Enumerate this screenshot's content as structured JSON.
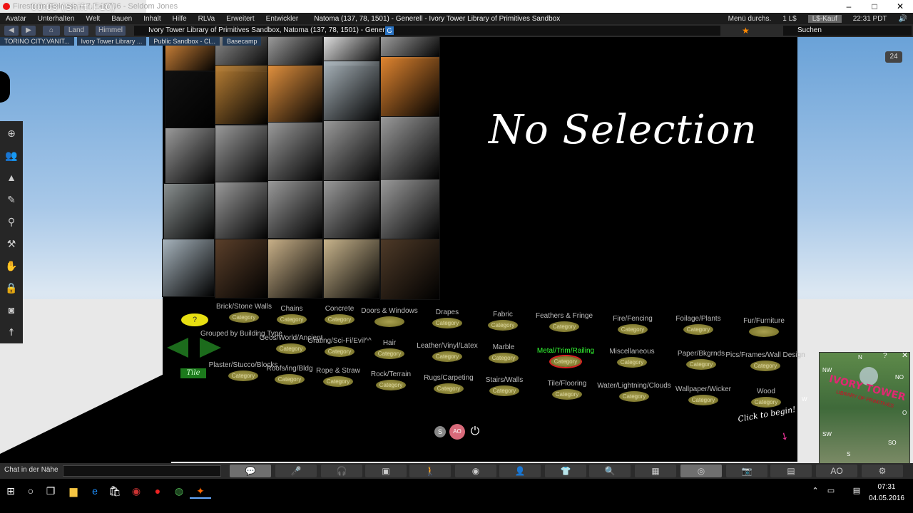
{
  "window": {
    "title": "Firestorm-Release 4.7.7.48706 - Seldom Jones",
    "recording_overlay": "00:03 (Shift+F10)",
    "controls": [
      "–",
      "□",
      "✕"
    ]
  },
  "menu": {
    "items": [
      "Avatar",
      "Unterhalten",
      "Welt",
      "Bauen",
      "Inhalt",
      "Hilfe",
      "RLVa",
      "Erweitert",
      "Entwickler"
    ],
    "location": "Natoma (137, 78, 1501) - Generell - Ivory Tower Library of Primitives Sandbox",
    "search_menu": "Menü durchs.",
    "balance": "1 L$",
    "buy": "L$-Kauf",
    "time": "22:31 PDT"
  },
  "nav": {
    "land": "Land",
    "sky": "Himmel",
    "url": "Ivory Tower Library of Primitives Sandbox, Natoma (137, 78, 1501) - Generell",
    "search_placeholder": "Suchen"
  },
  "favorites": [
    "TORINO CITY.VANIT...",
    "Ivory Tower Library ...",
    "Public Sandbox - Cl...",
    "Basecamp"
  ],
  "scene": {
    "no_selection": "No Selection",
    "badge": "24",
    "click_to_begin": "Click to begin!",
    "tile_label": "Tile",
    "grouped_label": "Grouped by Building Type",
    "hud_ao": "AO"
  },
  "categories": [
    {
      "label": "Brick/Stone Walls",
      "btn": "Category",
      "active": false
    },
    {
      "label": "Chains",
      "btn": "Category",
      "active": false
    },
    {
      "label": "Concrete",
      "btn": "Category",
      "active": false
    },
    {
      "label": "Doors & Windows",
      "btn": "",
      "active": false
    },
    {
      "label": "Drapes",
      "btn": "Category",
      "active": false
    },
    {
      "label": "Fabric",
      "btn": "Category",
      "active": false
    },
    {
      "label": "Feathers & Fringe",
      "btn": "Category",
      "active": false
    },
    {
      "label": "Fire/Fencing",
      "btn": "Category",
      "active": false
    },
    {
      "label": "Foilage/Plants",
      "btn": "Category",
      "active": false
    },
    {
      "label": "Fur/Furniture",
      "btn": "",
      "active": false
    },
    {
      "label": "Geos/World/Ancient",
      "btn": "Category",
      "active": false
    },
    {
      "label": "Grating/Sci-Fi/Evil^^",
      "btn": "Category",
      "active": false
    },
    {
      "label": "Hair",
      "btn": "Category",
      "active": false
    },
    {
      "label": "Leather/Vinyl/Latex",
      "btn": "Category",
      "active": false
    },
    {
      "label": "Marble",
      "btn": "Category",
      "active": false
    },
    {
      "label": "Metal/Trim/Railing",
      "btn": "Category",
      "active": true
    },
    {
      "label": "Miscellaneous",
      "btn": "Category",
      "active": false
    },
    {
      "label": "Paper/Bkgrnds",
      "btn": "Category",
      "active": false
    },
    {
      "label": "Pics/Frames/Wall Design",
      "btn": "Category",
      "active": false
    },
    {
      "label": "Plaster/Stucco/Blocks",
      "btn": "Category",
      "active": false
    },
    {
      "label": "Roofs/ing/Bldg",
      "btn": "Category",
      "active": false
    },
    {
      "label": "Rope & Straw",
      "btn": "Category",
      "active": false
    },
    {
      "label": "Rock/Terrain",
      "btn": "Category",
      "active": false
    },
    {
      "label": "Rugs/Carpeting",
      "btn": "Category",
      "active": false
    },
    {
      "label": "Stairs/Walls",
      "btn": "Category",
      "active": false
    },
    {
      "label": "Tile/Flooring",
      "btn": "Category",
      "active": false
    },
    {
      "label": "Water/Lightning/Clouds",
      "btn": "Category",
      "active": false
    },
    {
      "label": "Wallpaper/Wicker",
      "btn": "Category",
      "active": false
    },
    {
      "label": "Wood",
      "btn": "Category",
      "active": false
    }
  ],
  "minimap": {
    "logo": "IVORY TOWER",
    "subtitle": "LIBRARY OF PRIMITIVES",
    "dirs": [
      "N",
      "NW",
      "NO",
      "W",
      "O",
      "SW",
      "S",
      "SO"
    ]
  },
  "bottombar": {
    "chat_label": "Chat in der Nähe",
    "ao": "AO"
  },
  "taskbar": {
    "time": "07:31",
    "date": "04.05.2016"
  },
  "colors": {
    "active_category": "#33ff33",
    "category_button": "#8a8436",
    "panel": "#000000",
    "sky": "#a8c8e8"
  }
}
